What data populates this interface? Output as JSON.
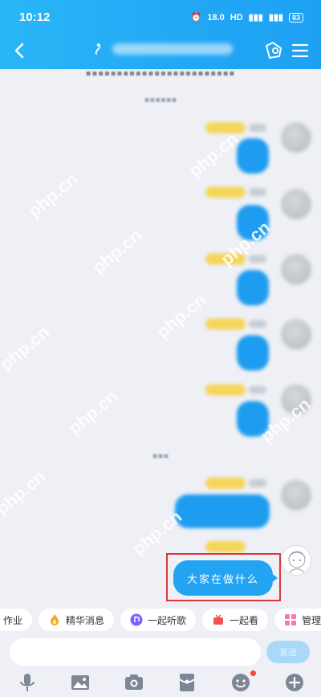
{
  "status_bar": {
    "time": "10:12",
    "net_speed": "18.0",
    "network_labels": [
      "HD",
      "4G",
      "4G"
    ],
    "battery": "83"
  },
  "header": {
    "back_icon": "chevron-left-icon",
    "group_icon": "group-info-icon",
    "menu_icon": "hamburger-menu-icon"
  },
  "chat": {
    "highlighted_message": "大家在做什么"
  },
  "quick_actions": [
    {
      "label": "作业",
      "icon": "homework-icon",
      "color": "#3b82f6"
    },
    {
      "label": "精华消息",
      "icon": "flame-icon",
      "color": "#f5a623"
    },
    {
      "label": "一起听歌",
      "icon": "music-icon",
      "color": "#7b61ff"
    },
    {
      "label": "一起看",
      "icon": "tv-icon",
      "color": "#f0524f"
    },
    {
      "label": "管理",
      "icon": "manage-icon",
      "color": "#f27bb0"
    }
  ],
  "input": {
    "value": "",
    "send_label": "发送"
  },
  "toolbar": [
    {
      "icon": "microphone-icon"
    },
    {
      "icon": "image-icon"
    },
    {
      "icon": "camera-icon"
    },
    {
      "icon": "red-packet-icon"
    },
    {
      "icon": "emoji-icon"
    },
    {
      "icon": "plus-icon"
    }
  ],
  "colors": {
    "accent": "#22a4f3",
    "highlight_border": "#d8383a"
  },
  "watermark": "php.cn"
}
